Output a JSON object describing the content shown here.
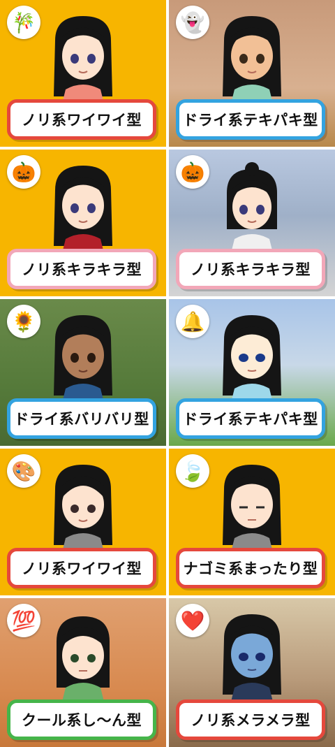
{
  "tiles": [
    {
      "label": "ノリ系ワイワイ型",
      "icon_name": "bamboo-tanabata-icon",
      "icon": "🎋",
      "border": "#e5483c"
    },
    {
      "label": "ドライ系テキパキ型",
      "icon_name": "ghost-icon",
      "icon": "👻",
      "border": "#33a3e0"
    },
    {
      "label": "ノリ系キラキラ型",
      "icon_name": "pumpkin-icon",
      "icon": "🎃",
      "border": "#f2a7b8"
    },
    {
      "label": "ノリ系キラキラ型",
      "icon_name": "pumpkin-icon",
      "icon": "🎃",
      "border": "#f2a7b8"
    },
    {
      "label": "ドライ系バリバリ型",
      "icon_name": "sunflower-icon",
      "icon": "🌻",
      "border": "#33a3e0"
    },
    {
      "label": "ドライ系テキパキ型",
      "icon_name": "bell-icon",
      "icon": "🔔",
      "border": "#33a3e0"
    },
    {
      "label": "ノリ系ワイワイ型",
      "icon_name": "palette-icon",
      "icon": "🎨",
      "border": "#e5483c"
    },
    {
      "label": "ナゴミ系まったり型",
      "icon_name": "leaves-icon",
      "icon": "🍃",
      "border": "#e5483c"
    },
    {
      "label": "クール系し〜ん型",
      "icon_name": "hundred-scorpion-icon",
      "icon": "💯",
      "border": "#46b54a"
    },
    {
      "label": "ノリ系メラメラ型",
      "icon_name": "heart-icon",
      "icon": "❤️",
      "border": "#e5483c"
    }
  ]
}
